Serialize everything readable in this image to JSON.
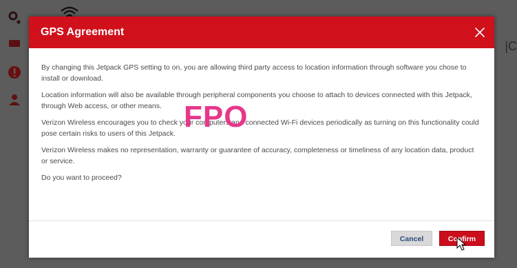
{
  "background": {
    "sidebar_icons": [
      "settings-gear-icon",
      "message-icon",
      "alert-icon",
      "user-icon"
    ],
    "status_icon": "wifi-icon",
    "right_peek_text": "|C"
  },
  "modal": {
    "title": "GPS Agreement",
    "close_icon": "close-icon",
    "paragraphs": [
      "By changing this Jetpack GPS setting to on, you are allowing third party access to location information through software you chose to install or download.",
      "Location information will also be available through peripheral components you choose to attach to devices connected with this Jetpack, through Web access, or other means.",
      "Verizon Wireless encourages you to check your computers and connected Wi-Fi devices periodically as turning on this functionality could pose certain risks to users of this Jetpack.",
      "Verizon Wireless makes no representation, warranty or guarantee of accuracy, completeness or timeliness of any location data, product or service.",
      "Do you want to proceed?"
    ],
    "watermark": "FPO",
    "buttons": {
      "cancel": "Cancel",
      "confirm": "Confirm"
    }
  },
  "colors": {
    "header_red": "#d0101b",
    "confirm_red": "#cc0d1b",
    "watermark_pink": "#e6378a",
    "backdrop": "#5c5c5c"
  }
}
